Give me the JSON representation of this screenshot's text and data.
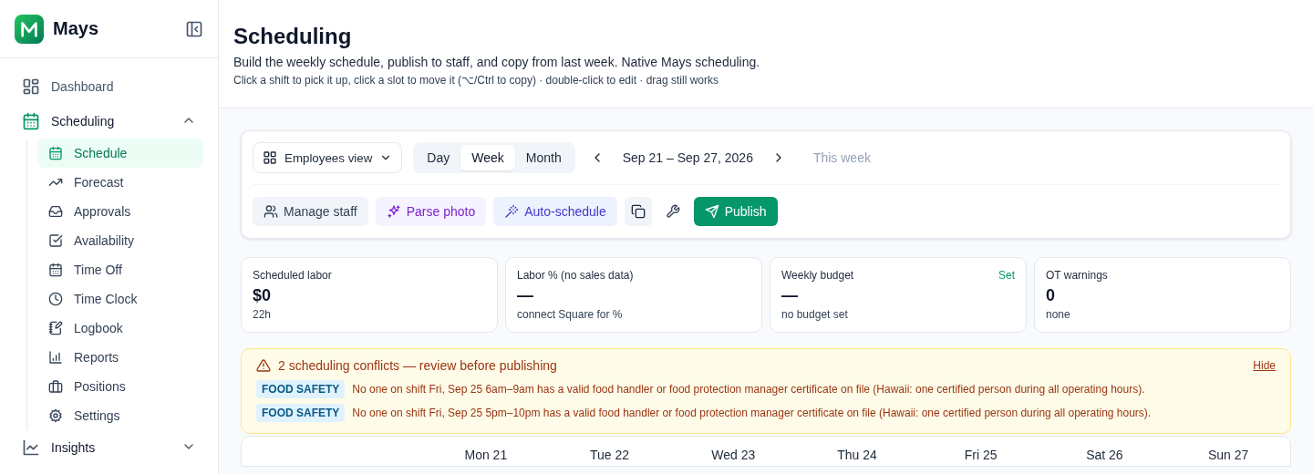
{
  "sidebar": {
    "brand": "Mays",
    "items": [
      {
        "kind": "link",
        "label": "Dashboard",
        "selected": false
      },
      {
        "kind": "group",
        "label": "Scheduling",
        "expanded": true,
        "children": [
          {
            "label": "Schedule",
            "selected": true
          },
          {
            "label": "Forecast",
            "selected": false
          },
          {
            "label": "Approvals",
            "selected": false
          },
          {
            "label": "Availability",
            "selected": false
          },
          {
            "label": "Time Off",
            "selected": false
          },
          {
            "label": "Time Clock",
            "selected": false
          },
          {
            "label": "Logbook",
            "selected": false
          },
          {
            "label": "Reports",
            "selected": false
          },
          {
            "label": "Positions",
            "selected": false
          },
          {
            "label": "Settings",
            "selected": false
          }
        ]
      },
      {
        "kind": "group",
        "label": "Insights",
        "expanded": false
      }
    ]
  },
  "header": {
    "title": "Scheduling",
    "subtitle": "Build the weekly schedule, publish to staff, and copy from last week. Native Mays scheduling.",
    "hint": "Click a shift to pick it up, click a slot to move it (⌥/Ctrl to copy) · double-click to edit · drag still works"
  },
  "toolbar": {
    "view_select": "Employees view",
    "ranges": [
      {
        "label": "Day",
        "selected": false
      },
      {
        "label": "Week",
        "selected": true
      },
      {
        "label": "Month",
        "selected": false
      }
    ],
    "date_range": "Sep 21 – Sep 27, 2026",
    "this_week": {
      "label": "This week",
      "disabled": true
    },
    "actions": [
      {
        "kind": "neutral",
        "label": "Manage staff"
      },
      {
        "kind": "purple",
        "label": "Parse photo"
      },
      {
        "kind": "indigo",
        "label": "Auto-schedule"
      },
      {
        "kind": "icon"
      },
      {
        "kind": "plain"
      },
      {
        "kind": "primary",
        "label": "Publish"
      }
    ]
  },
  "stats": [
    {
      "label": "Scheduled labor",
      "value": "$0",
      "note": "22h"
    },
    {
      "label": "Labor % (no sales data)",
      "value": "—",
      "note": "connect Square for %"
    },
    {
      "label": "Weekly budget",
      "value": "—",
      "note": "no budget set",
      "link": "Set"
    },
    {
      "label": "OT warnings",
      "value": "0",
      "note": "none"
    }
  ],
  "conflicts": {
    "title": "2 scheduling conflicts — review before publishing",
    "hide": "Hide",
    "items": [
      {
        "tag": "FOOD SAFETY",
        "message": "No one on shift Fri, Sep 25 6am–9am has a valid food handler or food protection manager certificate on file (Hawaii: one certified person during all operating hours)."
      },
      {
        "tag": "FOOD SAFETY",
        "message": "No one on shift Fri, Sep 25 5pm–10pm has a valid food handler or food protection manager certificate on file (Hawaii: one certified person during all operating hours)."
      }
    ]
  },
  "calendar": {
    "days": [
      "Mon 21",
      "Tue 22",
      "Wed 23",
      "Thu 24",
      "Fri 25",
      "Sat 26",
      "Sun 27"
    ]
  }
}
